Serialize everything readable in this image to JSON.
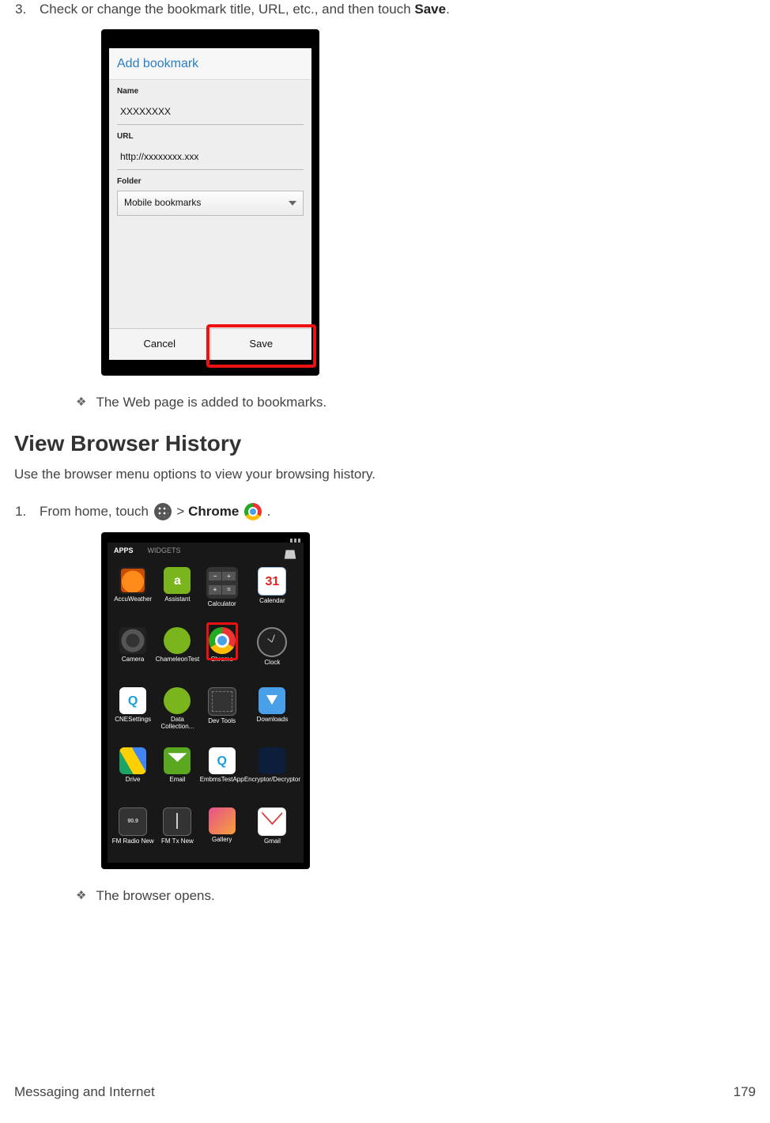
{
  "step3": {
    "number": "3.",
    "text_before": "Check or change the bookmark title, URL, etc., and then touch ",
    "strong": "Save",
    "text_after": "."
  },
  "bookmark_screen": {
    "title": "Add bookmark",
    "name_label": "Name",
    "name_value": "XXXXXXXX",
    "url_label": "URL",
    "url_value": "http://xxxxxxxx.xxx",
    "folder_label": "Folder",
    "folder_value": "Mobile bookmarks",
    "cancel": "Cancel",
    "save": "Save"
  },
  "result1": "The Web page is added to bookmarks.",
  "section": {
    "heading": "View Browser History",
    "sub": "Use the browser menu options to view your browsing history."
  },
  "step1": {
    "number": "1.",
    "text_before": "From home, touch ",
    "gt": " > ",
    "chrome_word": "Chrome",
    "text_after": " ."
  },
  "apps_screen": {
    "tab_apps": "APPS",
    "tab_widgets": "WIDGETS",
    "apps": [
      {
        "label": "AccuWeather"
      },
      {
        "label": "Assistant"
      },
      {
        "label": "Calculator"
      },
      {
        "label": "Calendar",
        "glyph": "31"
      },
      {
        "label": "Camera"
      },
      {
        "label": "ChameleonTest"
      },
      {
        "label": "Chrome",
        "highlight": true
      },
      {
        "label": "Clock"
      },
      {
        "label": "CNESettings"
      },
      {
        "label": "Data Collection..."
      },
      {
        "label": "Dev Tools"
      },
      {
        "label": "Downloads"
      },
      {
        "label": "Drive"
      },
      {
        "label": "Email"
      },
      {
        "label": "EmbmsTestApp"
      },
      {
        "label": "Encryptor/Decryptor"
      },
      {
        "label": "FM Radio New"
      },
      {
        "label": "FM Tx New"
      },
      {
        "label": "Gallery"
      },
      {
        "label": "Gmail"
      }
    ]
  },
  "result2": "The browser opens.",
  "footer": {
    "left": "Messaging and Internet",
    "right": "179"
  }
}
